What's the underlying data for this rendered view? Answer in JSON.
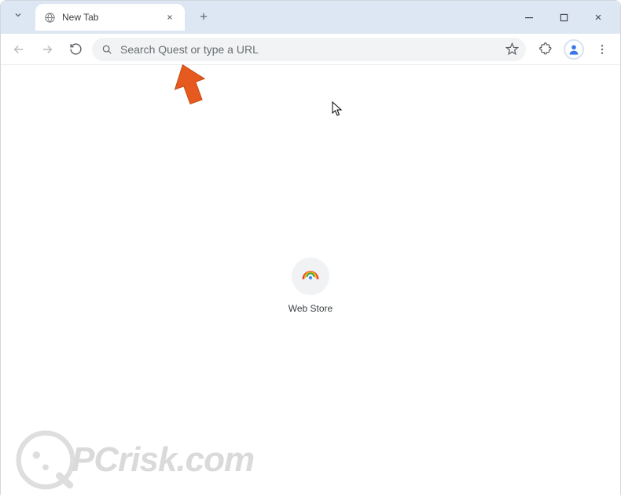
{
  "tab": {
    "title": "New Tab"
  },
  "omnibox": {
    "placeholder": "Search Quest or type a URL"
  },
  "shortcuts": [
    {
      "label": "Web Store"
    }
  ],
  "watermark": {
    "text": "PCrisk.com"
  }
}
